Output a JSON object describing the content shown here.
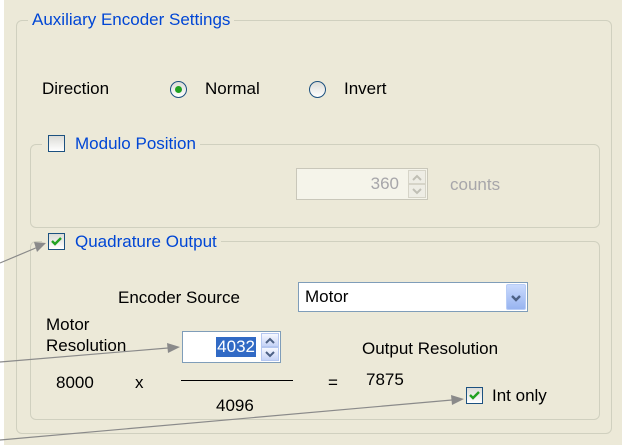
{
  "aux": {
    "title": "Auxiliary Encoder Settings",
    "direction_label": "Direction",
    "direction_options": [
      "Normal",
      "Invert"
    ],
    "direction_selected": "Normal"
  },
  "modulo": {
    "title": "Modulo Position",
    "checked": false,
    "value": "360",
    "unit": "counts"
  },
  "quad": {
    "title": "Quadrature Output",
    "checked": true,
    "encoder_source_label": "Encoder Source",
    "encoder_source_value": "Motor",
    "motor_res_label_line1": "Motor",
    "motor_res_label_line2": "Resolution",
    "motor_res_value": "4032",
    "output_res_label": "Output Resolution",
    "eq_multiplier": "8000",
    "eq_times": "x",
    "eq_denominator": "4096",
    "eq_equals": "=",
    "eq_result": "7875",
    "int_only_label": "Int only",
    "int_only_checked": true
  },
  "colors": {
    "panel": "#ece9d8",
    "group_title": "#0046d5",
    "check": "#21a121",
    "arrow": "#7a7a7a"
  }
}
